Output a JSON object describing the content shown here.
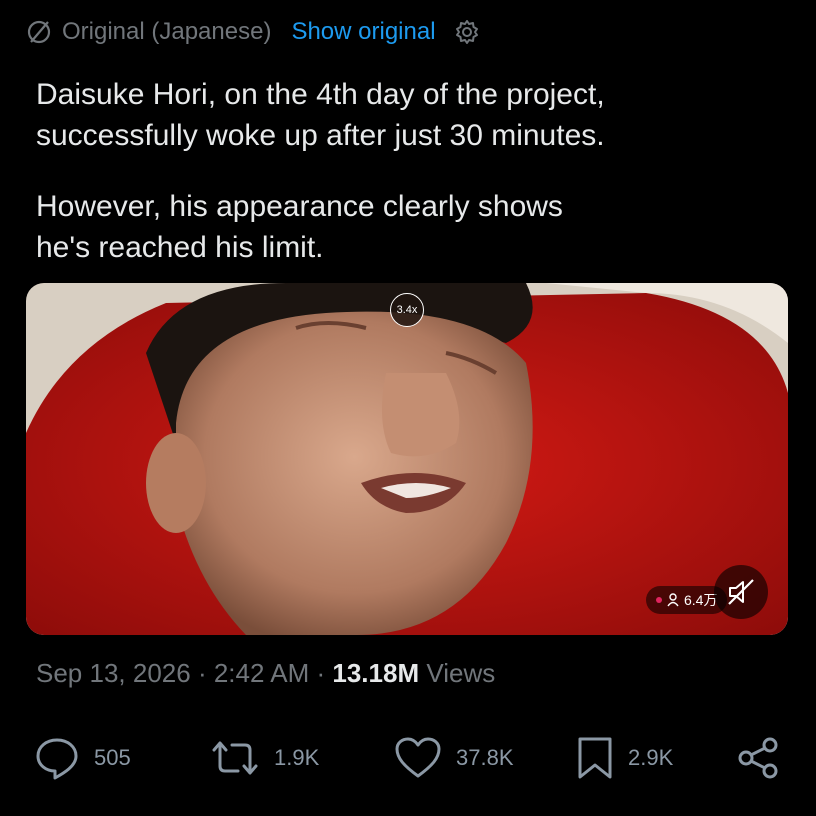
{
  "translation": {
    "label": "Original (Japanese)",
    "show_original": "Show original"
  },
  "tweet": {
    "paragraphs": [
      "Daisuke Hori, on the 4th day of the project,\nsuccessfully woke up after just 30 minutes.",
      "However, his appearance clearly shows\nhe's reached his limit."
    ]
  },
  "media": {
    "speed": "3.4x",
    "viewers": "6.4万",
    "live_dot_color": "#e0245e"
  },
  "meta": {
    "date": "Sep 13, 2026",
    "separator": "·",
    "time": "2:42 AM",
    "views_count": "13.18M",
    "views_label": "Views"
  },
  "actions": {
    "replies": "505",
    "reposts": "1.9K",
    "likes": "37.8K",
    "bookmarks": "2.9K"
  },
  "colors": {
    "background": "#000000",
    "text": "#e7e9ea",
    "muted": "#71767b",
    "link": "#1d9bf0"
  }
}
